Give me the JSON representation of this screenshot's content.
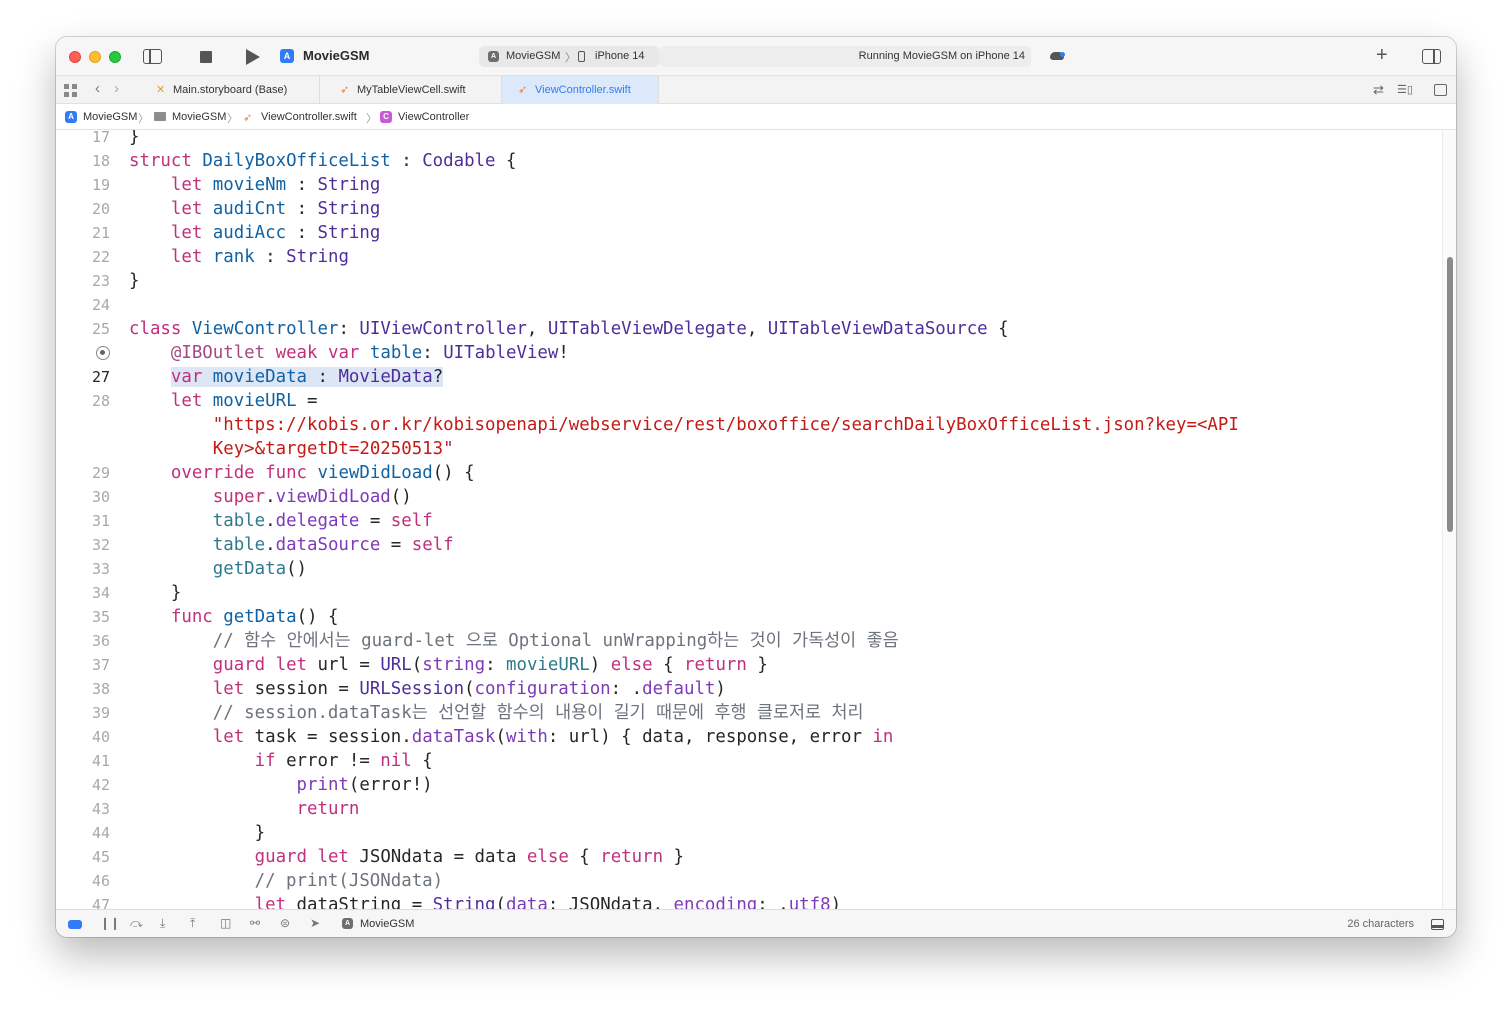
{
  "toolbar": {
    "project_name": "MovieGSM",
    "scheme_app": "MovieGSM",
    "scheme_separator": "〉",
    "scheme_device": "iPhone 14",
    "status": "Running MovieGSM on iPhone 14",
    "add_glyph": "+"
  },
  "tabs": [
    {
      "label": "Main.storyboard (Base)",
      "icon": "storyboard-icon",
      "glyph": "✕",
      "active": false
    },
    {
      "label": "MyTableViewCell.swift",
      "icon": "swift-icon",
      "glyph": "➶",
      "active": false
    },
    {
      "label": "ViewController.swift",
      "icon": "swift-icon",
      "glyph": "➶",
      "active": true
    }
  ],
  "breadcrumb": {
    "project": "MovieGSM",
    "folder": "MovieGSM",
    "file": "ViewController.swift",
    "symbol": "ViewController",
    "symbol_badge": "C",
    "separator": "〉"
  },
  "editor": {
    "current_line": 27,
    "breakpoint_line": 26,
    "selected_text": "var movieData : MovieData?",
    "line_numbers": [
      "17",
      "18",
      "19",
      "20",
      "21",
      "22",
      "23",
      "24",
      "25",
      "",
      "27",
      "28",
      "",
      "",
      "29",
      "30",
      "31",
      "32",
      "33",
      "34",
      "35",
      "36",
      "37",
      "38",
      "39",
      "40",
      "41",
      "42",
      "43",
      "44",
      "45",
      "46",
      "47"
    ]
  },
  "bottom_bar": {
    "target": "MovieGSM",
    "selection_count": "26 characters"
  },
  "colors": {
    "keyword": "#c0307c",
    "type": "#4d2e9a",
    "string": "#c41a16",
    "comment": "#6c737c",
    "accent": "#2f7cf6"
  }
}
